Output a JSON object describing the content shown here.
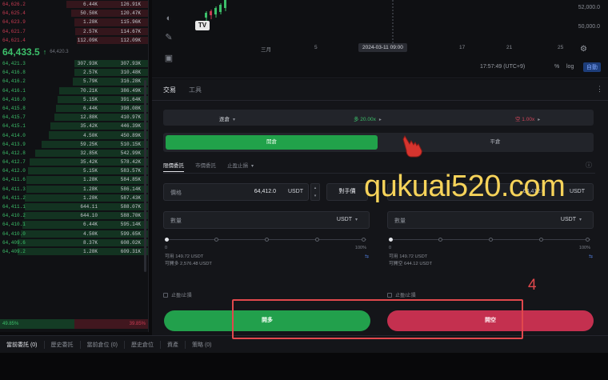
{
  "orderbook": {
    "asks": [
      {
        "price": "64,626.2",
        "size": "6.44K",
        "total": "126.91K",
        "depth": 0.55
      },
      {
        "price": "64,625.4",
        "size": "50.50K",
        "total": "120.47K",
        "depth": 0.52
      },
      {
        "price": "64,623.9",
        "size": "1.28K",
        "total": "115.96K",
        "depth": 0.5
      },
      {
        "price": "64,621.7",
        "size": "2.57K",
        "total": "114.67K",
        "depth": 0.49
      },
      {
        "price": "64,621.4",
        "size": "112.09K",
        "total": "112.09K",
        "depth": 0.48
      }
    ],
    "mid_price": "64,433.5",
    "mid_arrow": "↑",
    "mark_price": "64,420.3",
    "bids": [
      {
        "price": "64,421.3",
        "size": "307.93K",
        "total": "307.93K",
        "depth": 0.5
      },
      {
        "price": "64,416.8",
        "size": "2.57K",
        "total": "310.48K",
        "depth": 0.5
      },
      {
        "price": "64,416.2",
        "size": "5.79K",
        "total": "316.28K",
        "depth": 0.51
      },
      {
        "price": "64,416.1",
        "size": "70.21K",
        "total": "386.49K",
        "depth": 0.6
      },
      {
        "price": "64,416.0",
        "size": "5.15K",
        "total": "391.64K",
        "depth": 0.61
      },
      {
        "price": "64,415.8",
        "size": "6.44K",
        "total": "398.08K",
        "depth": 0.62
      },
      {
        "price": "64,415.7",
        "size": "12.88K",
        "total": "410.97K",
        "depth": 0.63
      },
      {
        "price": "64,415.1",
        "size": "35.42K",
        "total": "446.39K",
        "depth": 0.66
      },
      {
        "price": "64,414.0",
        "size": "4.50K",
        "total": "450.89K",
        "depth": 0.67
      },
      {
        "price": "64,413.9",
        "size": "59.25K",
        "total": "510.15K",
        "depth": 0.72
      },
      {
        "price": "64,412.8",
        "size": "32.85K",
        "total": "542.99K",
        "depth": 0.76
      },
      {
        "price": "64,412.7",
        "size": "35.42K",
        "total": "578.42K",
        "depth": 0.8
      },
      {
        "price": "64,412.0",
        "size": "5.15K",
        "total": "583.57K",
        "depth": 0.81
      },
      {
        "price": "64,411.6",
        "size": "1.28K",
        "total": "584.85K",
        "depth": 0.82
      },
      {
        "price": "64,411.3",
        "size": "1.28K",
        "total": "586.14K",
        "depth": 0.82
      },
      {
        "price": "64,411.2",
        "size": "1.28K",
        "total": "587.43K",
        "depth": 0.83
      },
      {
        "price": "64,411.1",
        "size": "644.11",
        "total": "588.07K",
        "depth": 0.83
      },
      {
        "price": "64,410.2",
        "size": "644.10",
        "total": "588.70K",
        "depth": 0.84
      },
      {
        "price": "64,410.1",
        "size": "6.44K",
        "total": "595.14K",
        "depth": 0.85
      },
      {
        "price": "64,410.0",
        "size": "4.50K",
        "total": "599.65K",
        "depth": 0.86
      },
      {
        "price": "64,409.6",
        "size": "8.37K",
        "total": "608.02K",
        "depth": 0.88
      },
      {
        "price": "64,409.2",
        "size": "1.28K",
        "total": "609.31K",
        "depth": 0.88
      }
    ],
    "ratio_bid": "49.85%",
    "ratio_ask": "39.85%"
  },
  "chart": {
    "price_label_1": "52,000.0",
    "price_label_2": "50,000.0",
    "tv_logo": "TV",
    "time_labels": [
      "三月",
      "5",
      "2024-03-11  09:00",
      "17",
      "21",
      "25"
    ],
    "clock": "17:57:49 (UTC+9)",
    "pct_label": "%",
    "log_label": "log",
    "auto_label": "自動"
  },
  "panel": {
    "tabs": [
      "交易",
      "工具"
    ],
    "mode": "逐倉",
    "leverage_long": "多 20.00x",
    "leverage_short": "空 1.00x",
    "open_label": "開倉",
    "close_label": "平倉",
    "order_tabs": [
      "限價委託",
      "市價委託",
      "止盈止損"
    ],
    "price_field": {
      "label": "價格",
      "value": "64,412.0",
      "unit": "USDT"
    },
    "counter_price_label": "對手價",
    "price_field_right": {
      "value": "64,412.0",
      "unit": "USDT"
    },
    "qty_left": {
      "label": "數量",
      "unit": "USDT"
    },
    "qty_right": {
      "label": "數量",
      "unit": "USDT"
    },
    "slider_min": "0",
    "slider_max": "100%",
    "avail_left_1": "可用 149.72 USDT",
    "avail_left_2": "可開多 2,576.48 USDT",
    "avail_right_1": "可用 149.72 USDT",
    "avail_right_2": "可開空 644.12 USDT",
    "tpsl_label": "止盈/止損",
    "long_button": "開多",
    "short_button": "開空"
  },
  "annotation": {
    "step": "4",
    "watermark": "qukuai520.com"
  },
  "bottom_tabs": [
    "當前委託 (0)",
    "歷史委託",
    "當前倉位 (0)",
    "歷史倉位",
    "資產",
    "策略 (0)"
  ],
  "colors": {
    "buy": "#21a24a",
    "sell": "#c4304f",
    "highlight": "#e1484c",
    "watermark": "#f6d35a"
  }
}
